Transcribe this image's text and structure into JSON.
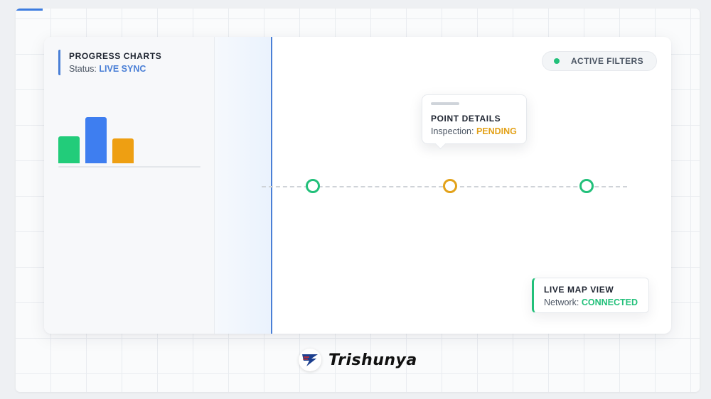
{
  "colors": {
    "accent_blue": "#4a7fd6",
    "green": "#22c07a",
    "amber": "#e3a21a",
    "bar_green": "#22cc7a",
    "bar_blue": "#3e7ef0",
    "bar_amber": "#ee9f12"
  },
  "progress": {
    "title": "PROGRESS CHARTS",
    "status_label": "Status:",
    "status_value": "LIVE SYNC",
    "bars": [
      {
        "color": "green",
        "level": 0.49
      },
      {
        "color": "blue",
        "level": 0.83
      },
      {
        "color": "amber",
        "level": 0.45
      }
    ]
  },
  "filters": {
    "icon": "status-dot-icon",
    "label": "ACTIVE FILTERS"
  },
  "tooltip": {
    "title": "POINT DETAILS",
    "status_label": "Inspection:",
    "status_value": "PENDING"
  },
  "timeline": {
    "nodes": [
      {
        "status": "complete",
        "color": "green"
      },
      {
        "status": "pending",
        "color": "amber"
      },
      {
        "status": "complete",
        "color": "green"
      }
    ]
  },
  "map_view": {
    "title": "LIVE MAP VIEW",
    "status_label": "Network:",
    "status_value": "CONNECTED"
  },
  "brand": {
    "icon": "trishunya-logo-icon",
    "name": "Trishunya"
  }
}
